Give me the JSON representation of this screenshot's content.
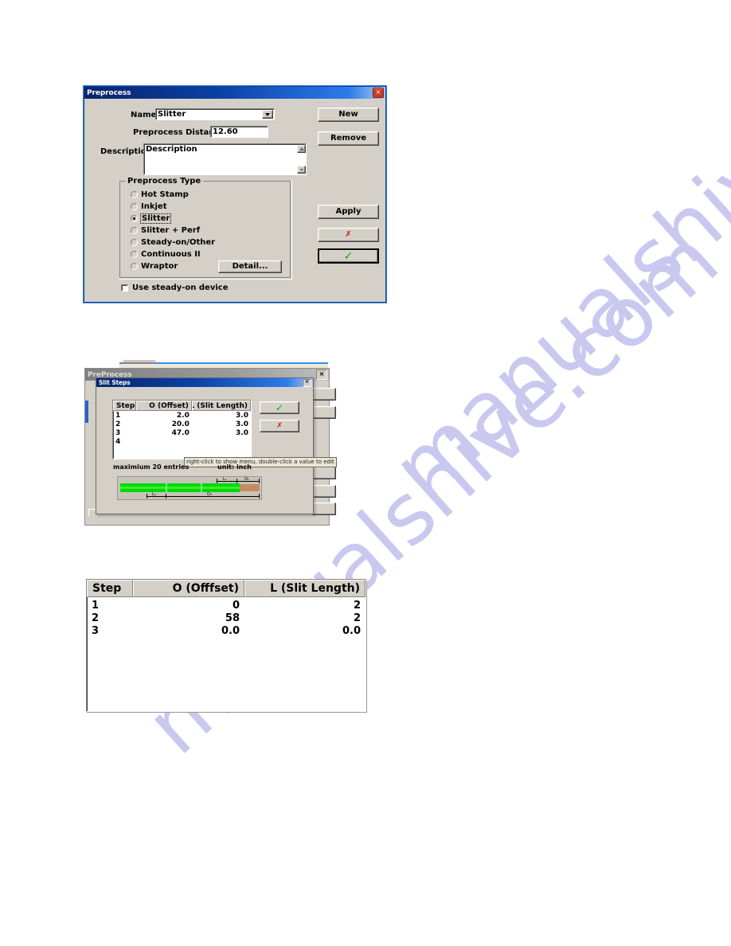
{
  "watermark": {
    "line1": "manualshive.com",
    "line2": "manualshive.com"
  },
  "figure1": {
    "title": "Preprocess",
    "close_icon": "×",
    "name_label": "Name:",
    "name_value": "Slitter",
    "distance_label": "Preprocess Distance:",
    "distance_value": "12.60",
    "description_label": "Description",
    "description_value": "Description",
    "group_title": "Preprocess Type",
    "radios": [
      {
        "label": "Hot Stamp",
        "selected": false
      },
      {
        "label": "Inkjet",
        "selected": false
      },
      {
        "label": "Slitter",
        "selected": true
      },
      {
        "label": "Slitter + Perf",
        "selected": false
      },
      {
        "label": "Steady-on/Other",
        "selected": false
      },
      {
        "label": "Continuous II",
        "selected": false
      },
      {
        "label": "Wraptor",
        "selected": false
      }
    ],
    "detail_button": "Detail...",
    "checkbox_label": "Use steady-on device",
    "checkbox_checked": false,
    "new_button": "New",
    "remove_button": "Remove",
    "apply_button": "Apply",
    "cancel_icon": "✗",
    "ok_icon": "✓"
  },
  "figure2": {
    "parent_title": "PreProcess",
    "parent_close_icon": "×",
    "dialog_title": "Slit Steps",
    "dialog_close_icon": "×",
    "ok_icon": "✓",
    "cancel_icon": "✗",
    "tooltip": "right-click to show menu, double-click a value to edit",
    "max_entries_label": "maximium 20 entries",
    "unit_label": "unit: inch",
    "table": {
      "headers": [
        "Step",
        "O (Offset)",
        "L (Slit Length)"
      ],
      "rows": [
        [
          "1",
          "2.0",
          "3.0"
        ],
        [
          "2",
          "20.0",
          "3.0"
        ],
        [
          "3",
          "47.0",
          "3.0"
        ],
        [
          "4",
          "",
          ""
        ]
      ]
    },
    "diagram_labels": {
      "l1": "L₁",
      "o1": "O₁",
      "l2": "L₂",
      "o2": "O₂"
    }
  },
  "figure3": {
    "headers": [
      "Step",
      "O (Offfset)",
      "L (Slit Length)"
    ],
    "rows": [
      [
        "1",
        "0",
        "2"
      ],
      [
        "2",
        "58",
        "2"
      ],
      [
        "3",
        "0.0",
        "0.0"
      ]
    ]
  }
}
